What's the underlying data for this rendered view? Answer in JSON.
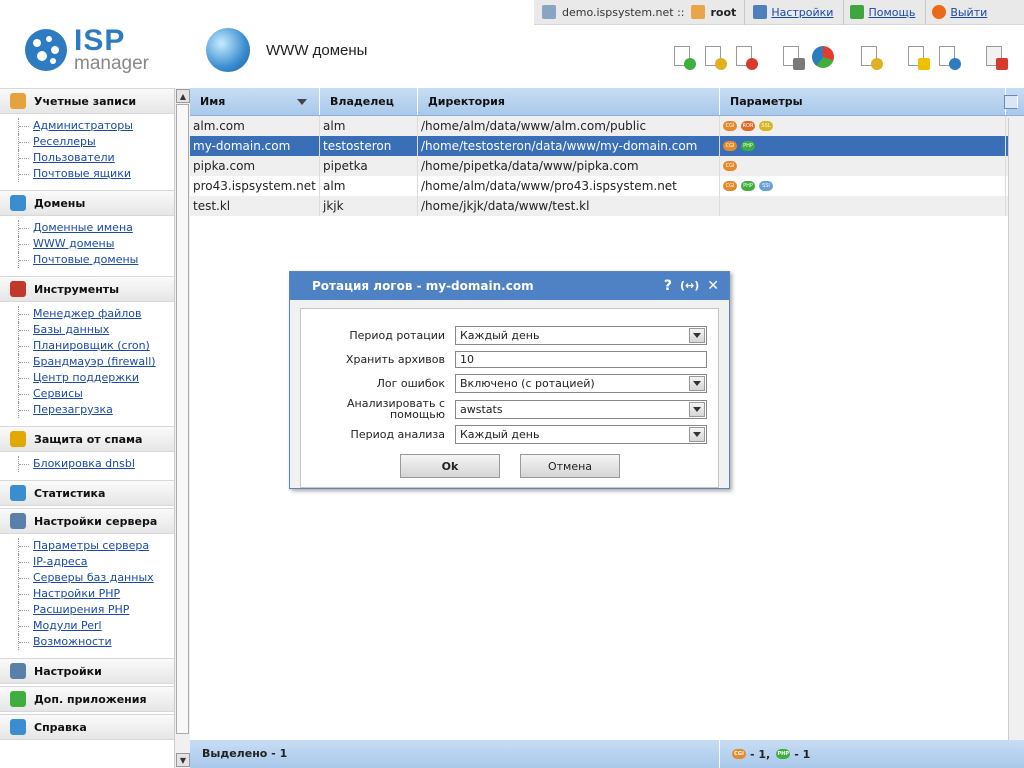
{
  "topbar": {
    "server": "demo.ispsystem.net ::",
    "user": "root",
    "settings": "Настройки",
    "help": "Помощь",
    "logout": "Выйти"
  },
  "logo": {
    "isp": "ISP",
    "manager": "manager"
  },
  "page": {
    "title": "WWW домены"
  },
  "sidebar": {
    "sections": [
      {
        "title": "Учетные записи",
        "items": [
          "Администраторы",
          "Реселлеры",
          "Пользователи",
          "Почтовые ящики"
        ]
      },
      {
        "title": "Домены",
        "items": [
          "Доменные имена",
          "WWW домены",
          "Почтовые домены"
        ]
      },
      {
        "title": "Инструменты",
        "items": [
          "Менеджер файлов",
          "Базы данных",
          "Планировщик (cron)",
          "Брандмауэр (firewall)",
          "Центр поддержки",
          "Сервисы",
          "Перезагрузка"
        ]
      },
      {
        "title": "Защита от спама",
        "items": [
          "Блокировка dnsbl"
        ]
      },
      {
        "title": "Статистика",
        "items": []
      },
      {
        "title": "Настройки сервера",
        "items": [
          "Параметры сервера",
          "IP-адреса",
          "Серверы баз данных",
          "Настройки PHP",
          "Расширения PHP",
          "Модули Perl",
          "Возможности"
        ]
      },
      {
        "title": "Настройки",
        "items": []
      },
      {
        "title": "Доп. приложения",
        "items": []
      },
      {
        "title": "Справка",
        "items": []
      }
    ]
  },
  "grid": {
    "columns": [
      "Имя",
      "Владелец",
      "Директория",
      "Параметры"
    ],
    "rows": [
      {
        "name": "alm.com",
        "owner": "alm",
        "dir": "/home/alm/data/www/alm.com/public",
        "params": [
          "cgi",
          "ror",
          "ssl"
        ]
      },
      {
        "name": "my-domain.com",
        "owner": "testosteron",
        "dir": "/home/testosteron/data/www/my-domain.com",
        "params": [
          "cgi",
          "php"
        ]
      },
      {
        "name": "pipka.com",
        "owner": "pipetka",
        "dir": "/home/pipetka/data/www/pipka.com",
        "params": [
          "cgi"
        ]
      },
      {
        "name": "pro43.ispsystem.net",
        "owner": "alm",
        "dir": "/home/alm/data/www/pro43.ispsystem.net",
        "params": [
          "cgi",
          "php",
          "ssi"
        ]
      },
      {
        "name": "test.kl",
        "owner": "jkjk",
        "dir": "/home/jkjk/data/www/test.kl",
        "params": []
      }
    ],
    "selected_row": 1,
    "footer_selected": "Выделено - 1",
    "footer_cgi_count": "- 1,",
    "footer_php_count": "- 1"
  },
  "dialog": {
    "title": "Ротация логов - my-domain.com",
    "help_glyph": "?",
    "expand_glyph": "(↔)",
    "close_glyph": "✕",
    "fields": {
      "period_label": "Период ротации",
      "period_value": "Каждый день",
      "archives_label": "Хранить архивов",
      "archives_value": "10",
      "errlog_label": "Лог ошибок",
      "errlog_value": "Включено (с ротацией)",
      "analyze_label": "Анализировать с помощью",
      "analyze_value": "awstats",
      "analyze_period_label": "Период анализа",
      "analyze_period_value": "Каждый день"
    },
    "ok": "Ok",
    "cancel": "Отмена"
  },
  "colors": {
    "accent": "#4e82c4",
    "header": "#a9c8ea",
    "selected": "#3a6fb8",
    "link": "#1a4aa5"
  }
}
